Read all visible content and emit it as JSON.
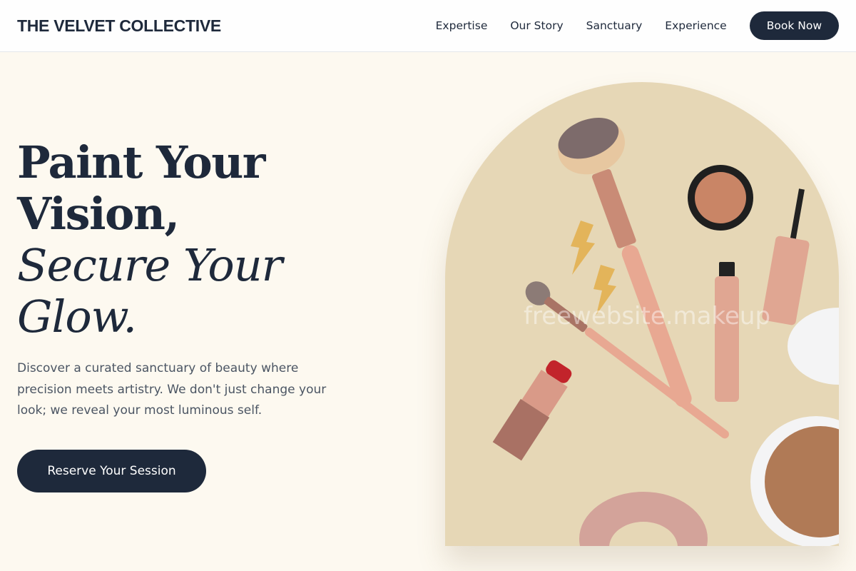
{
  "header": {
    "brand": "THE VELVET COLLECTIVE",
    "nav": [
      "Expertise",
      "Our Story",
      "Sanctuary",
      "Experience"
    ],
    "cta_label": "Book Now"
  },
  "hero": {
    "title_line1": "Paint Your",
    "title_line2": "Vision,",
    "title_line3": "Secure Your",
    "title_line4": "Glow.",
    "description": "Discover a curated sanctuary of beauty where precision meets artistry. We don't just change your look; we reveal your most luminous self.",
    "cta_label": "Reserve Your Session",
    "image_watermark": "freewebsite.makeup"
  },
  "colors": {
    "navy": "#1e293b",
    "cream": "#fdf9f0",
    "arch_bg": "#e6d7b6",
    "rose_gold": "#d9a08c"
  },
  "icons": [
    "makeup-brush-icon",
    "lipstick-icon",
    "mascara-icon",
    "compact-icon",
    "lightning-earring-icon",
    "scrunchie-icon"
  ]
}
